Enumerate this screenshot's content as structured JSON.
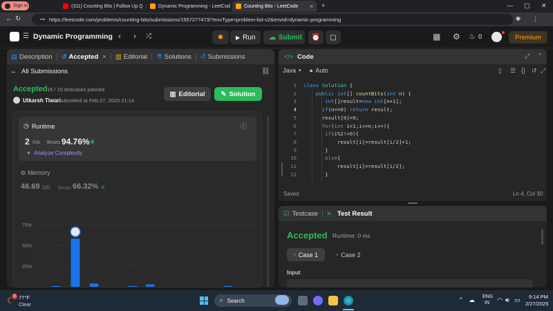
{
  "browser": {
    "tabs": [
      {
        "label": "Sign in",
        "icon": "profile-icon"
      },
      {
        "label": "(311) Counting Bits | Follow Up Q",
        "icon": "youtube-icon"
      },
      {
        "label": "Dynamic Programming - LeetCod",
        "icon": "leetcode-icon"
      },
      {
        "label": "Counting Bits - LeetCode",
        "icon": "leetcode-icon",
        "active": true
      }
    ],
    "url": "https://leetcode.com/problems/counting-bits/submissions/1557277473/?envType=problem-list-v2&envId=dynamic-programming"
  },
  "topbar": {
    "list_title": "Dynamic Programming",
    "run_label": "Run",
    "submit_label": "Submit",
    "streak_count": "0",
    "premium_label": "Premium",
    "accent": "#ffa116"
  },
  "left": {
    "tabs": [
      "Description",
      "Accepted",
      "Editorial",
      "Solutions",
      "Submissions"
    ],
    "all_submissions": "All Submissions",
    "status": "Accepted",
    "testcases": "15 / 15 testcases passed",
    "user": "Utkarsh Tiwari",
    "submitted": "submitted at Feb 27, 2025 21:14",
    "editorial_btn": "Editorial",
    "solution_btn": "Solution",
    "runtime": {
      "title": "Runtime",
      "value": "2",
      "unit": "ms",
      "beats_label": "Beats",
      "beats": "94.76%",
      "analyze": "Analyze Complexity"
    },
    "memory": {
      "title": "Memory",
      "value": "46.69",
      "unit": "MB",
      "beats_label": "Beats",
      "beats": "66.32%"
    },
    "chart_ticks": [
      "75%",
      "50%",
      "25%"
    ]
  },
  "chart_data": {
    "type": "bar",
    "title": "",
    "xlabel": "",
    "ylabel": "",
    "ylim": [
      0,
      85
    ],
    "yticks": [
      "75%",
      "50%",
      "25%"
    ],
    "bars": [
      {
        "x": 1,
        "value": 1
      },
      {
        "x": 2,
        "value": 58,
        "highlight": true
      },
      {
        "x": 3,
        "value": 4
      },
      {
        "x": 4,
        "value": 1
      },
      {
        "x": 5,
        "value": 3
      },
      {
        "x": 6,
        "value": 1
      }
    ],
    "color": "#1a73e8"
  },
  "code": {
    "title": "Code",
    "language": "Java",
    "mode": "Auto",
    "lines": [
      "class Solution {",
      "    public int[] countBits(int n) {",
      "       int[]result=new int[n+1];",
      "      if(n==0) return result;",
      "      result[0]=0;",
      "      for(int i=1;i<=n;i++){",
      "       if(i%2!=0){",
      "           result[i]=result[i/2]+1;",
      "       }",
      "       else{",
      "           result[i]=result[i/2];",
      "       }"
    ],
    "saved": "Saved",
    "cursor": "Ln 4, Col 30"
  },
  "bottom": {
    "tab_testcase": "Testcase",
    "tab_result": "Test Result",
    "status": "Accepted",
    "runtime": "Runtime: 0 ms",
    "case1": "Case 1",
    "case2": "Case 2",
    "input_label": "Input"
  },
  "taskbar": {
    "weather_temp": "77°F",
    "weather_text": "Clear",
    "weather_badge": "9",
    "search_label": "Search",
    "lang": "ENG",
    "region": "IN",
    "time": "9:14 PM",
    "date": "2/27/2025"
  }
}
